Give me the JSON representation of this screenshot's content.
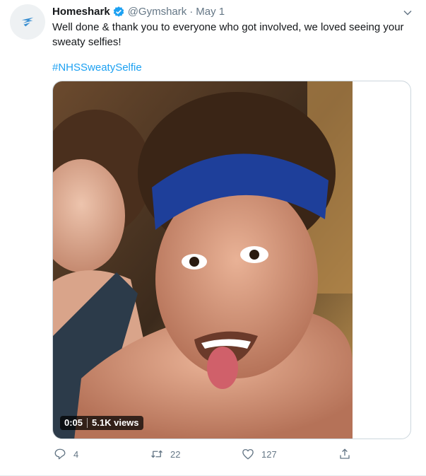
{
  "tweet": {
    "display_name": "Homeshark",
    "handle": "@Gymshark",
    "separator": "·",
    "date": "May 1",
    "text": "Well done & thank you to everyone who got involved, we loved seeing your sweaty selfies!",
    "hashtag": "#NHSSweatySelfie"
  },
  "video": {
    "duration": "0:05",
    "views": "5.1K views"
  },
  "actions": {
    "reply_count": "4",
    "retweet_count": "22",
    "like_count": "127"
  },
  "colors": {
    "link": "#1da1f2",
    "verified": "#1da1f2",
    "secondary_text": "#657786"
  },
  "icons": {
    "avatar": "gymshark-logo-icon",
    "verified": "verified-badge-icon",
    "menu": "chevron-down-icon",
    "reply": "reply-icon",
    "retweet": "retweet-icon",
    "like": "heart-icon",
    "share": "share-icon"
  }
}
